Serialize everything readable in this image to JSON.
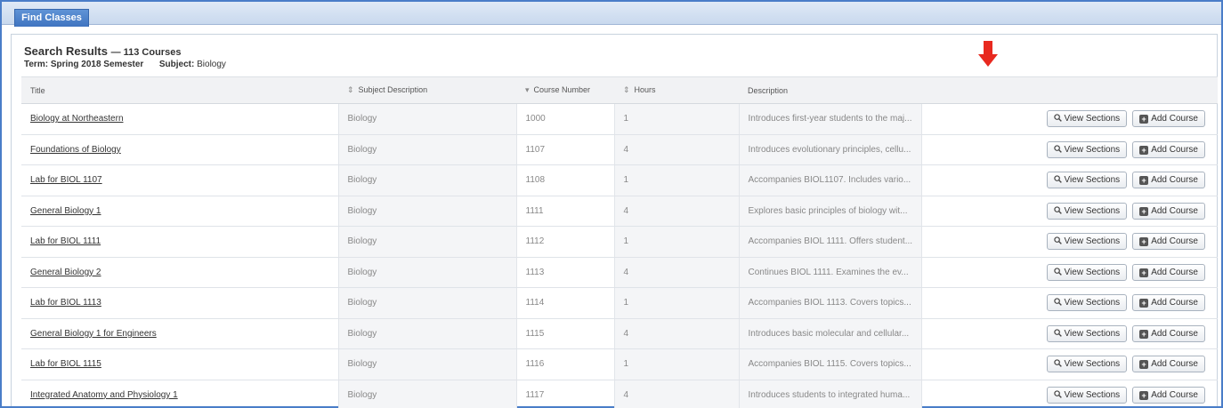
{
  "tab": {
    "label": "Find Classes"
  },
  "search": {
    "title": "Search Results",
    "count": "— 113 Courses",
    "term_label": "Term:",
    "term_value": "Spring 2018 Semester",
    "subject_label": "Subject:",
    "subject_value": "Biology"
  },
  "columns": {
    "title": "Title",
    "subject": "Subject Description",
    "course_number": "Course Number",
    "hours": "Hours",
    "description": "Description"
  },
  "buttons": {
    "view_sections": "View Sections",
    "add_course": "Add Course"
  },
  "rows": [
    {
      "title": "Biology at Northeastern",
      "subject": "Biology",
      "number": "1000",
      "hours": "1",
      "description": "Introduces first-year students to the maj..."
    },
    {
      "title": "Foundations of Biology",
      "subject": "Biology",
      "number": "1107",
      "hours": "4",
      "description": "Introduces evolutionary principles, cellu..."
    },
    {
      "title": "Lab for BIOL 1107",
      "subject": "Biology",
      "number": "1108",
      "hours": "1",
      "description": "Accompanies BIOL1107. Includes vario..."
    },
    {
      "title": "General Biology 1",
      "subject": "Biology",
      "number": "1111",
      "hours": "4",
      "description": "Explores basic principles of biology wit..."
    },
    {
      "title": "Lab for BIOL 1111",
      "subject": "Biology",
      "number": "1112",
      "hours": "1",
      "description": "Accompanies BIOL 1111. Offers student..."
    },
    {
      "title": "General Biology 2",
      "subject": "Biology",
      "number": "1113",
      "hours": "4",
      "description": "Continues BIOL 1111. Examines the ev..."
    },
    {
      "title": "Lab for BIOL 1113",
      "subject": "Biology",
      "number": "1114",
      "hours": "1",
      "description": "Accompanies BIOL 1113. Covers topics..."
    },
    {
      "title": "General Biology 1 for Engineers",
      "subject": "Biology",
      "number": "1115",
      "hours": "4",
      "description": "Introduces basic molecular and cellular..."
    },
    {
      "title": "Lab for BIOL 1115",
      "subject": "Biology",
      "number": "1116",
      "hours": "1",
      "description": "Accompanies BIOL 1115. Covers topics..."
    },
    {
      "title": "Integrated Anatomy and Physiology 1",
      "subject": "Biology",
      "number": "1117",
      "hours": "4",
      "description": "Introduces students to integrated huma..."
    }
  ],
  "colors": {
    "frame": "#4a7dc8",
    "tab": "#4a7fc4",
    "arrow": "#e8291f"
  },
  "icons": {
    "sort": "sort-icon",
    "view": "magnifier-icon",
    "add": "plus-icon",
    "annotation": "down-arrow-icon"
  }
}
